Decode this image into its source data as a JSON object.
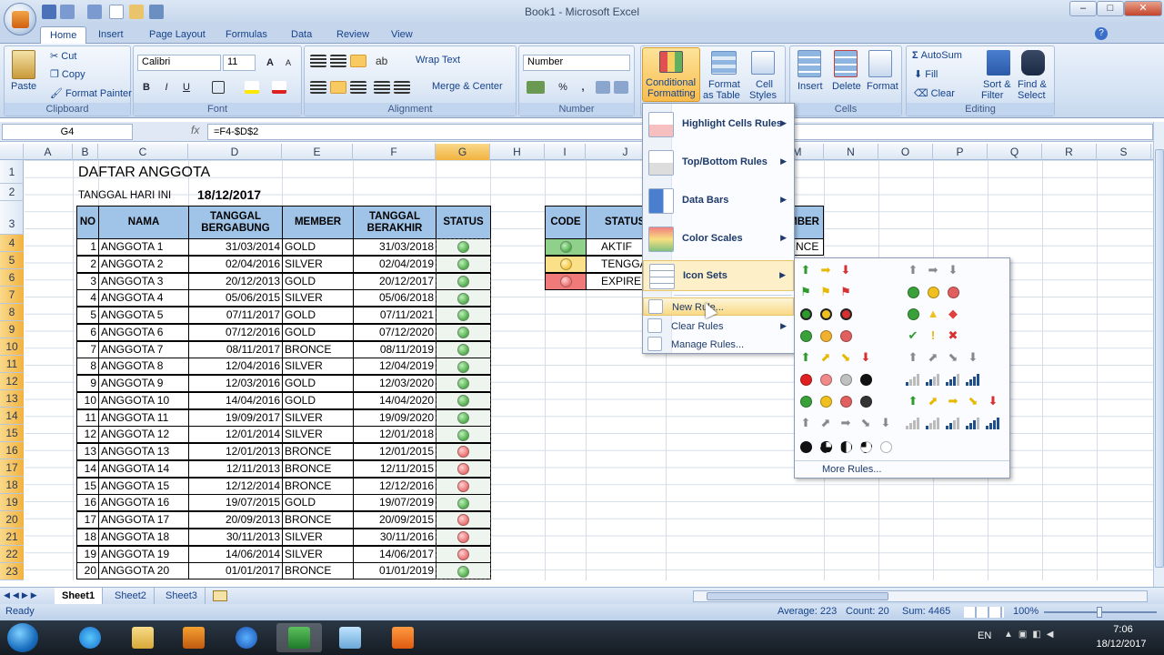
{
  "window": {
    "title": "Book1 - Microsoft Excel",
    "min": "–",
    "max": "□",
    "close": "✕"
  },
  "tabs": [
    "Home",
    "Insert",
    "Page Layout",
    "Formulas",
    "Data",
    "Review",
    "View"
  ],
  "ribbon": {
    "clipboard": {
      "label": "Clipboard",
      "paste": "Paste",
      "cut": "Cut",
      "copy": "Copy",
      "painter": "Format Painter"
    },
    "font": {
      "label": "Font",
      "name": "Calibri",
      "size": "11",
      "bold": "B",
      "italic": "I",
      "underline": "U",
      "grow": "A",
      "shrink": "A"
    },
    "alignment": {
      "label": "Alignment",
      "wrap": "Wrap Text",
      "merge": "Merge & Center"
    },
    "number": {
      "label": "Number",
      "format": "Number",
      "percent": "%",
      "comma": ","
    },
    "styles": {
      "cf1": "Conditional",
      "cf2": "Formatting",
      "ft1": "Format",
      "ft2": "as Table",
      "cs1": "Cell",
      "cs2": "Styles"
    },
    "cells": {
      "label": "Cells",
      "insert": "Insert",
      "delete": "Delete",
      "format": "Format"
    },
    "editing": {
      "label": "Editing",
      "autosum": "AutoSum",
      "fill": "Fill",
      "clear": "Clear",
      "sort1": "Sort &",
      "sort2": "Filter",
      "find1": "Find &",
      "find2": "Select"
    }
  },
  "formula_bar": {
    "name_box": "G4",
    "fx": "fx",
    "formula": "=F4-$D$2"
  },
  "columns": [
    "A",
    "B",
    "C",
    "D",
    "E",
    "F",
    "G",
    "H",
    "I",
    "J",
    "K",
    "L",
    "M",
    "N",
    "O",
    "P",
    "Q",
    "R",
    "S"
  ],
  "rows": [
    "1",
    "2",
    "3",
    "4",
    "5",
    "6",
    "7",
    "8",
    "9",
    "10",
    "11",
    "12",
    "13",
    "14",
    "15",
    "16",
    "17",
    "18",
    "19",
    "20",
    "21",
    "22",
    "23"
  ],
  "sheet": {
    "title": "DAFTAR ANGGOTA",
    "date_label": "TANGGAL HARI INI",
    "date_value": "18/12/2017",
    "headers": {
      "no": "NO",
      "nama": "NAMA",
      "tb1": "TANGGAL",
      "tb2": "BERGABUNG",
      "member": "MEMBER",
      "te1": "TANGGAL",
      "te2": "BERAKHIR",
      "status": "STATUS"
    },
    "members": [
      {
        "no": "1",
        "nama": "ANGGOTA 1",
        "join": "31/03/2014",
        "member": "GOLD",
        "end": "31/03/2018",
        "status": "green"
      },
      {
        "no": "2",
        "nama": "ANGGOTA 2",
        "join": "02/04/2016",
        "member": "SILVER",
        "end": "02/04/2019",
        "status": "green"
      },
      {
        "no": "3",
        "nama": "ANGGOTA 3",
        "join": "20/12/2013",
        "member": "GOLD",
        "end": "20/12/2017",
        "status": "green"
      },
      {
        "no": "4",
        "nama": "ANGGOTA 4",
        "join": "05/06/2015",
        "member": "SILVER",
        "end": "05/06/2018",
        "status": "green"
      },
      {
        "no": "5",
        "nama": "ANGGOTA 5",
        "join": "07/11/2017",
        "member": "GOLD",
        "end": "07/11/2021",
        "status": "green"
      },
      {
        "no": "6",
        "nama": "ANGGOTA 6",
        "join": "07/12/2016",
        "member": "GOLD",
        "end": "07/12/2020",
        "status": "green"
      },
      {
        "no": "7",
        "nama": "ANGGOTA 7",
        "join": "08/11/2017",
        "member": "BRONCE",
        "end": "08/11/2019",
        "status": "green"
      },
      {
        "no": "8",
        "nama": "ANGGOTA 8",
        "join": "12/04/2016",
        "member": "SILVER",
        "end": "12/04/2019",
        "status": "green"
      },
      {
        "no": "9",
        "nama": "ANGGOTA 9",
        "join": "12/03/2016",
        "member": "GOLD",
        "end": "12/03/2020",
        "status": "green"
      },
      {
        "no": "10",
        "nama": "ANGGOTA 10",
        "join": "14/04/2016",
        "member": "GOLD",
        "end": "14/04/2020",
        "status": "green"
      },
      {
        "no": "11",
        "nama": "ANGGOTA 11",
        "join": "19/09/2017",
        "member": "SILVER",
        "end": "19/09/2020",
        "status": "green"
      },
      {
        "no": "12",
        "nama": "ANGGOTA 12",
        "join": "12/01/2014",
        "member": "SILVER",
        "end": "12/01/2018",
        "status": "green"
      },
      {
        "no": "13",
        "nama": "ANGGOTA 13",
        "join": "12/01/2013",
        "member": "BRONCE",
        "end": "12/01/2015",
        "status": "red"
      },
      {
        "no": "14",
        "nama": "ANGGOTA 14",
        "join": "12/11/2013",
        "member": "BRONCE",
        "end": "12/11/2015",
        "status": "red"
      },
      {
        "no": "15",
        "nama": "ANGGOTA 15",
        "join": "12/12/2014",
        "member": "BRONCE",
        "end": "12/12/2016",
        "status": "red"
      },
      {
        "no": "16",
        "nama": "ANGGOTA 16",
        "join": "19/07/2015",
        "member": "GOLD",
        "end": "19/07/2019",
        "status": "green"
      },
      {
        "no": "17",
        "nama": "ANGGOTA 17",
        "join": "20/09/2013",
        "member": "BRONCE",
        "end": "20/09/2015",
        "status": "red"
      },
      {
        "no": "18",
        "nama": "ANGGOTA 18",
        "join": "30/11/2013",
        "member": "SILVER",
        "end": "30/11/2016",
        "status": "red"
      },
      {
        "no": "19",
        "nama": "ANGGOTA 19",
        "join": "14/06/2014",
        "member": "SILVER",
        "end": "14/06/2017",
        "status": "red"
      },
      {
        "no": "20",
        "nama": "ANGGOTA 20",
        "join": "01/01/2017",
        "member": "BRONCE",
        "end": "01/01/2019",
        "status": "green"
      }
    ],
    "legend": {
      "code": "CODE",
      "status": "STATUS",
      "member_partial": "MBER",
      "rows": [
        {
          "color": "green",
          "label": "AKTIF",
          "extra": "NCE"
        },
        {
          "color": "yellow",
          "label": "TENGGA",
          "extra": ""
        },
        {
          "color": "red",
          "label": "EXPIRED",
          "extra": ""
        }
      ]
    }
  },
  "cf_menu": {
    "items": [
      "Highlight Cells Rules",
      "Top/Bottom Rules",
      "Data Bars",
      "Color Scales",
      "Icon Sets"
    ],
    "small": [
      "New Rule...",
      "Clear Rules",
      "Manage Rules..."
    ]
  },
  "iconsets_menu": {
    "more": "More Rules..."
  },
  "sheets": [
    "Sheet1",
    "Sheet2",
    "Sheet3"
  ],
  "status": {
    "ready": "Ready",
    "average": "Average: 223",
    "count": "Count: 20",
    "sum": "Sum: 4465",
    "zoom": "100%"
  },
  "taskbar": {
    "lang": "EN",
    "time": "7:06",
    "date": "18/12/2017"
  }
}
